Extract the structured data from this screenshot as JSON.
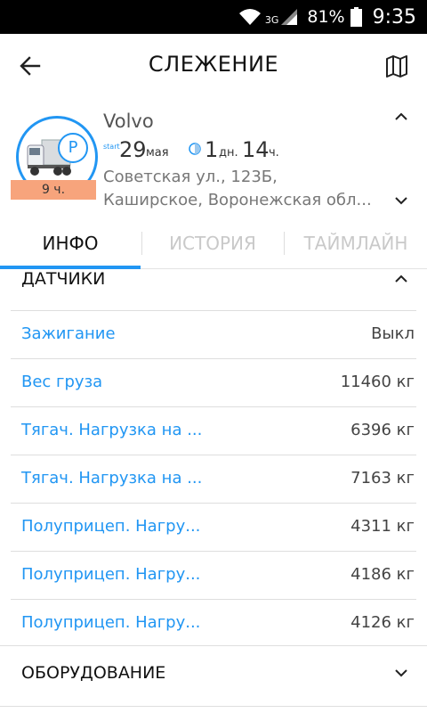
{
  "status_bar": {
    "network": "3G",
    "battery_percent": "81%",
    "time": "9:35"
  },
  "app_bar": {
    "title": "СЛЕЖЕНИЕ"
  },
  "vehicle": {
    "name": "Volvo",
    "duration_badge": "9 ч.",
    "start_label": "start",
    "start_day": "29",
    "start_month": "мая",
    "duration_days": "1",
    "duration_days_unit": "дн.",
    "duration_hours": "14",
    "duration_hours_unit": "ч.",
    "address_line1": "Советская ул., 123Б,",
    "address_line2": "Каширское, Воронежская обл...",
    "parking_symbol": "P"
  },
  "tabs": [
    {
      "label": "ИНФО",
      "active": true
    },
    {
      "label": "ИСТОРИЯ",
      "active": false
    },
    {
      "label": "ТАЙМЛАЙН",
      "active": false
    }
  ],
  "sensors": {
    "title": "ДАТЧИКИ",
    "items": [
      {
        "label": "Зажигание",
        "value": "Выкл"
      },
      {
        "label": "Вес груза",
        "value": "11460 кг"
      },
      {
        "label": "Тягач. Нагрузка на ...",
        "value": "6396 кг"
      },
      {
        "label": "Тягач. Нагрузка на ...",
        "value": "7163 кг"
      },
      {
        "label": "Полуприцеп. Нагру...",
        "value": "4311 кг"
      },
      {
        "label": "Полуприцеп. Нагру...",
        "value": "4186 кг"
      },
      {
        "label": "Полуприцеп. Нагру...",
        "value": "4126 кг"
      }
    ]
  },
  "equipment": {
    "title": "ОБОРУДОВАНИЕ"
  },
  "colors": {
    "accent": "#2196f3",
    "badge": "#f7a47c"
  }
}
